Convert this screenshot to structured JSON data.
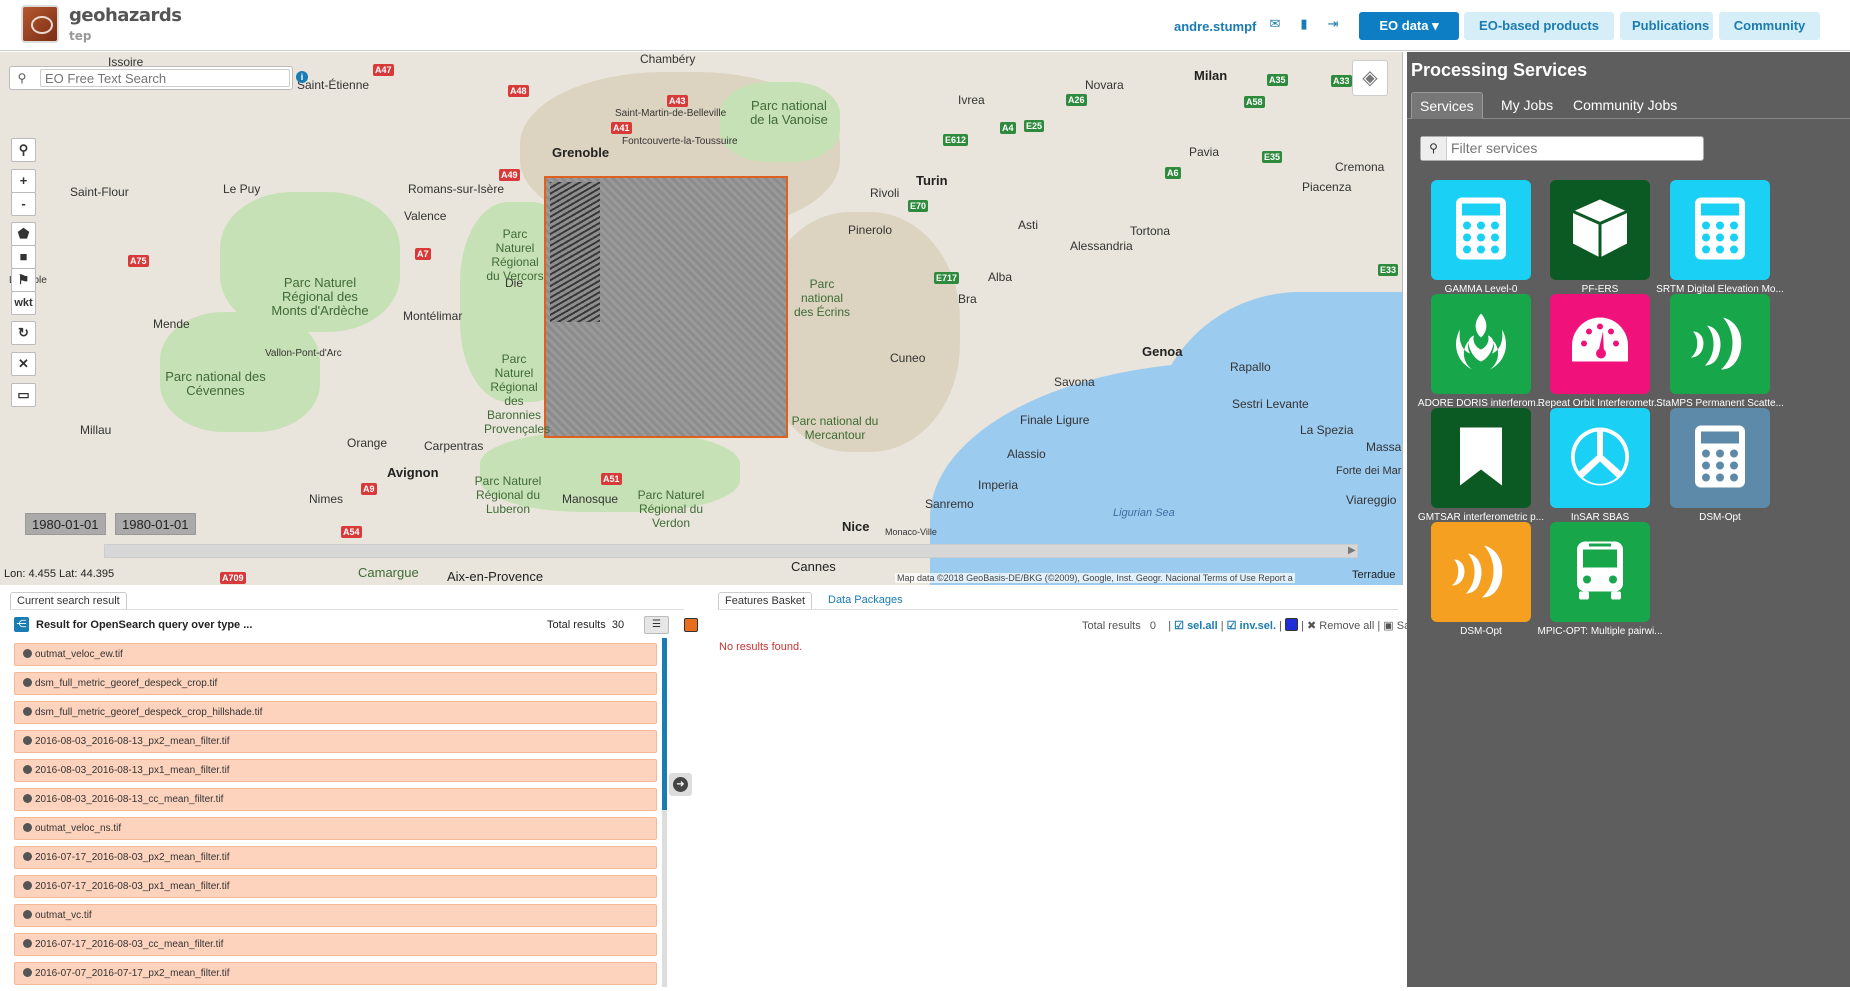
{
  "header": {
    "logo_name": "geohazards",
    "logo_sub": "tep",
    "user": "andre.stumpf",
    "nav": [
      {
        "label": "EO data ▾",
        "primary": true
      },
      {
        "label": "EO-based products",
        "primary": false
      },
      {
        "label": "Publications",
        "primary": false
      },
      {
        "label": "Community",
        "primary": false
      }
    ]
  },
  "map": {
    "search_placeholder": "EO Free Text Search",
    "tools": [
      "search-icon",
      "zoom-in",
      "zoom-out",
      "polygon-icon",
      "rectangle-icon",
      "marker-icon",
      "wkt",
      "refresh-icon",
      "fullscreen-icon",
      "ruler-icon"
    ],
    "zoom_in": "+",
    "zoom_out": "-",
    "wkt": "wkt",
    "date_start": "1980-01-01",
    "date_end": "1980-01-01",
    "coords": "Lon: 4.455 Lat: 44.395",
    "attribution": "Map data ©2018 GeoBasis-DE/BKG (©2009), Google, Inst. Geogr. Nacional    Terms of Use    Report a",
    "credit": "Terradue",
    "places": {
      "issoire": "Issoire",
      "saint_etienne": "Saint-Étienne",
      "chambery": "Chambéry",
      "novara": "Novara",
      "milan": "Milan",
      "grenoble": "Grenoble",
      "saint_martin": "Saint-Martin-de-Belleville",
      "fontcouverte": "Fontcouverte-la-Toussuire",
      "ivrea": "Ivrea",
      "pavia": "Pavia",
      "cremona": "Cremona",
      "saint_flour": "Saint-Flour",
      "le_puy": "Le Puy",
      "romans": "Romans-sur-Isère",
      "valence": "Valence",
      "rivoli": "Rivoli",
      "turin": "Turin",
      "asti": "Asti",
      "alessandria": "Alessandria",
      "tortona": "Tortona",
      "piacenza": "Piacenza",
      "pinerolo": "Pinerolo",
      "laguiole": "Laguiole",
      "die": "Die",
      "alba": "Alba",
      "bra": "Bra",
      "montelimar": "Montélimar",
      "mende": "Mende",
      "vallon": "Vallon-Pont-d'Arc",
      "cuneo": "Cuneo",
      "genoa": "Genoa",
      "rapallo": "Rapallo",
      "savona": "Savona",
      "sestri": "Sestri Levante",
      "la_spezia": "La Spezia",
      "massa": "Massa",
      "millau": "Millau",
      "orange": "Orange",
      "carpentras": "Carpentras",
      "finale": "Finale Ligure",
      "alassio": "Alassio",
      "avignon": "Avignon",
      "imperia": "Imperia",
      "nimes": "Nimes",
      "manosque": "Manosque",
      "sanremo": "Sanremo",
      "forte": "Forte dei Marmi",
      "viareggio": "Viareggio",
      "nice": "Nice",
      "monaco": "Monaco-Ville",
      "aix": "Aix-en-Provence",
      "cannes": "Cannes",
      "camargue": "Camargue"
    },
    "parks": {
      "vanoise": "Parc national de la Vanoise",
      "monts_ardeche": "Parc Naturel Régional des Monts d'Ardèche",
      "cevennes": "Parc national des Cévennes",
      "vercors": "Parc Naturel Régional du Vercors",
      "baronnies": "Parc Naturel Régional des Baronnies Provençales",
      "mercantour": "Parc national du Mercantour",
      "luberon": "Parc Naturel Régional du Luberon",
      "verdon": "Parc Naturel Régional du Verdon",
      "ecrins": "Parc national des Écrins"
    },
    "sea": "Ligurian Sea",
    "roads": [
      "A47",
      "A48",
      "A43",
      "A41",
      "A49",
      "A7",
      "A75",
      "A9",
      "A51",
      "A54",
      "A709",
      "E612",
      "A4",
      "E25",
      "A26",
      "A35",
      "A58",
      "E70",
      "E717",
      "A6",
      "E35",
      "E33",
      "A33"
    ]
  },
  "results": {
    "tab": "Current search result",
    "title": "Result for OpenSearch query over type ...",
    "total_label": "Total results",
    "total": "30",
    "items": [
      "outmat_veloc_ew.tif",
      "dsm_full_metric_georef_despeck_crop.tif",
      "dsm_full_metric_georef_despeck_crop_hillshade.tif",
      "2016-08-03_2016-08-13_px2_mean_filter.tif",
      "2016-08-03_2016-08-13_px1_mean_filter.tif",
      "2016-08-03_2016-08-13_cc_mean_filter.tif",
      "outmat_veloc_ns.tif",
      "2016-07-17_2016-08-03_px2_mean_filter.tif",
      "2016-07-17_2016-08-03_px1_mean_filter.tif",
      "outmat_vc.tif",
      "2016-07-17_2016-08-03_cc_mean_filter.tif",
      "2016-07-07_2016-07-17_px2_mean_filter.tif"
    ]
  },
  "basket": {
    "tab_features": "Features Basket",
    "tab_packages": "Data Packages",
    "total_label": "Total results",
    "total": "0",
    "sel_all": "sel.all",
    "inv_sel": "inv.sel.",
    "remove_all": "Remove all",
    "save": "Save",
    "empty": "No results found."
  },
  "sidebar": {
    "title": "Processing Services",
    "tabs": [
      "Services",
      "My Jobs",
      "Community Jobs"
    ],
    "filter_placeholder": "Filter services",
    "services": [
      {
        "name": "GAMMA Level-0",
        "color": "#1ad0f5",
        "icon": "calculator-icon"
      },
      {
        "name": "PF-ERS",
        "color": "#0c5a23",
        "icon": "cube-icon"
      },
      {
        "name": "SRTM Digital Elevation Mo...",
        "color": "#1ad0f5",
        "icon": "calculator-icon"
      },
      {
        "name": "ADORE DORIS interferom...",
        "color": "#17a64a",
        "icon": "rebel-icon"
      },
      {
        "name": "Repeat Orbit Interferometr...",
        "color": "#f0127a",
        "icon": "dashboard-icon"
      },
      {
        "name": "StaMPS Permanent Scatte...",
        "color": "#17a64a",
        "icon": "wave-icon"
      },
      {
        "name": "GMTSAR interferometric p...",
        "color": "#0c5a23",
        "icon": "bookmark-icon"
      },
      {
        "name": "InSAR SBAS",
        "color": "#1ad0f5",
        "icon": "peace-icon"
      },
      {
        "name": "DSM-Opt",
        "color": "#5d8aa8",
        "icon": "calculator-icon"
      },
      {
        "name": "DSM-Opt",
        "color": "#f5a021",
        "icon": "wave-icon"
      },
      {
        "name": "MPIC-OPT: Multiple pairwi...",
        "color": "#17a64a",
        "icon": "bus-icon"
      }
    ]
  }
}
